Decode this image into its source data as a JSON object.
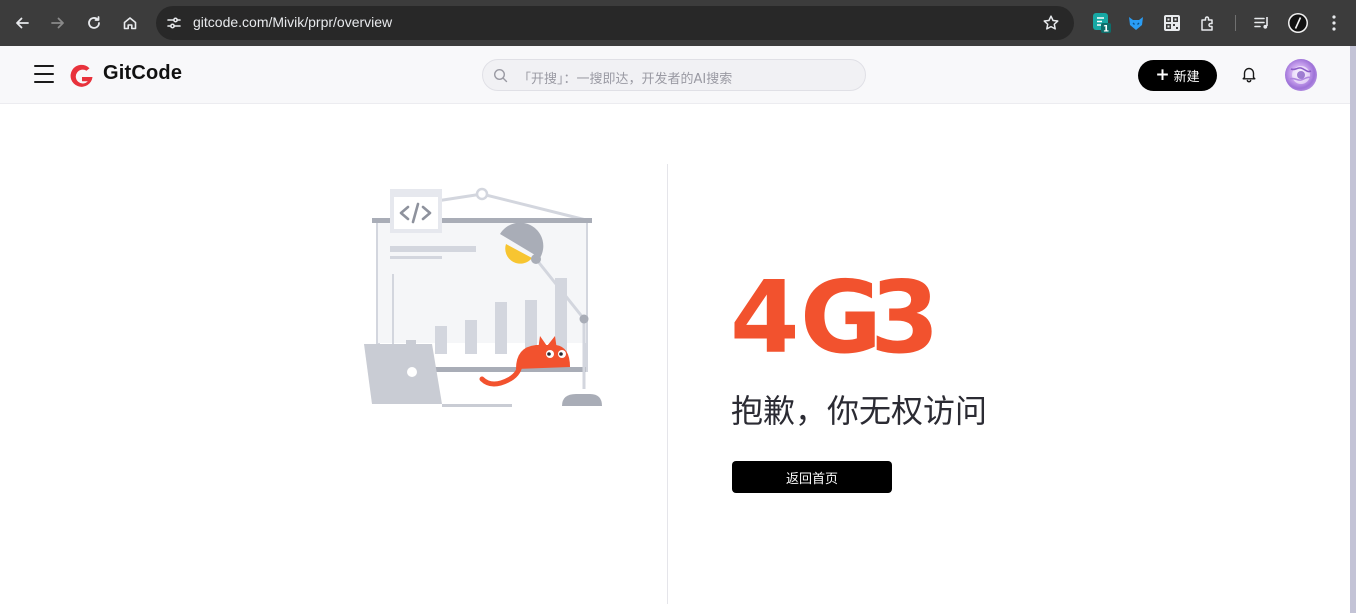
{
  "browser": {
    "url": "gitcode.com/Mivik/prpr/overview",
    "extension_badge": "1"
  },
  "header": {
    "logo_text": "GitCode",
    "search_placeholder": "「开搜」：一搜即达，开发者的AI搜索",
    "new_button_label": "新建"
  },
  "error": {
    "code_digits": [
      "4",
      "G",
      "3"
    ],
    "message": "抱歉，你无权访问",
    "home_button_label": "返回首页"
  },
  "colors": {
    "brand_red": "#e8323c",
    "code_orange": "#f2522e",
    "cat_orange": "#f2522e",
    "button_black": "#000000"
  }
}
